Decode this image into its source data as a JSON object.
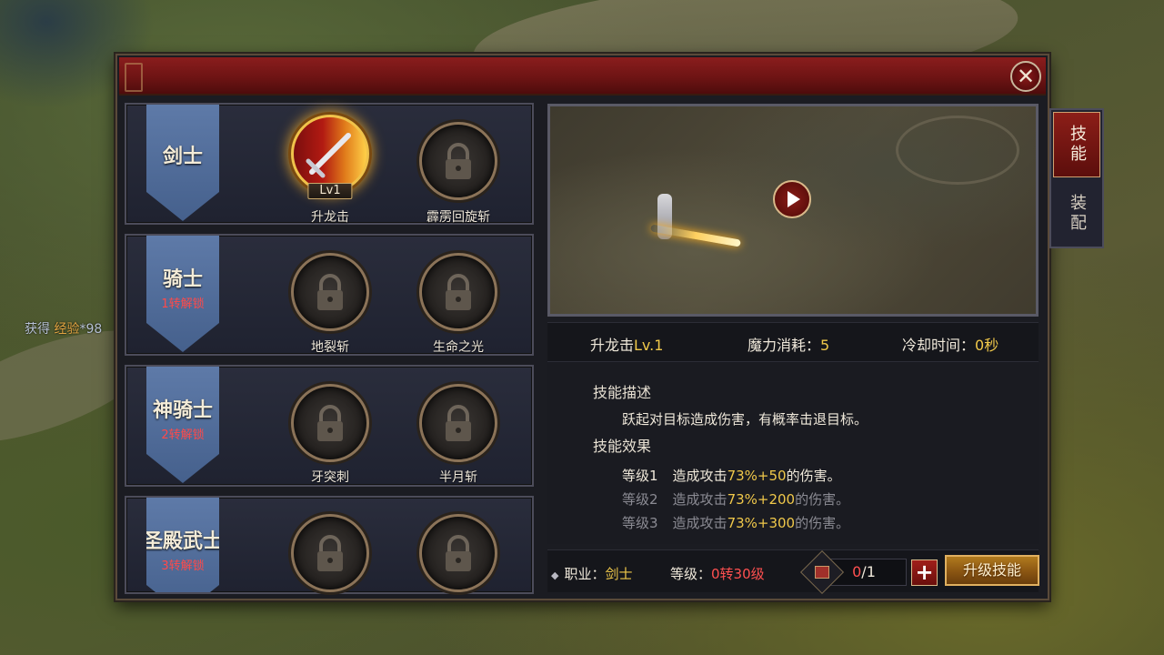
{
  "hud": {
    "xp_prefix": "获得",
    "xp_label": "经验",
    "xp_value": "*98"
  },
  "dialog": {
    "close_icon": "close-icon"
  },
  "classes": [
    {
      "name": "剑士",
      "unlock": "",
      "skills": [
        {
          "label": "升龙击",
          "level": "Lv1",
          "state": "active",
          "icon": "sword-icon"
        },
        {
          "label": "霹雳回旋斩",
          "level": "",
          "state": "locked",
          "icon": "lock-icon"
        }
      ]
    },
    {
      "name": "骑士",
      "unlock": "1转解锁",
      "skills": [
        {
          "label": "地裂斩",
          "level": "",
          "state": "locked",
          "icon": "lock-icon"
        },
        {
          "label": "生命之光",
          "level": "",
          "state": "locked",
          "icon": "lock-icon"
        }
      ]
    },
    {
      "name": "神骑士",
      "unlock": "2转解锁",
      "skills": [
        {
          "label": "牙突刺",
          "level": "",
          "state": "locked",
          "icon": "lock-icon"
        },
        {
          "label": "半月斩",
          "level": "",
          "state": "locked",
          "icon": "lock-icon"
        }
      ]
    },
    {
      "name": "圣殿武士",
      "unlock": "3转解锁",
      "skills": [
        {
          "label": "",
          "level": "",
          "state": "locked",
          "icon": "lock-icon"
        },
        {
          "label": "",
          "level": "",
          "state": "locked",
          "icon": "lock-icon"
        }
      ]
    }
  ],
  "detail": {
    "skill_name": "升龙击",
    "skill_level": "Lv.1",
    "mana_label": "魔力消耗：",
    "mana_value": "5",
    "cooldown_label": "冷却时间：",
    "cooldown_value": "0秒",
    "desc_heading": "技能描述",
    "desc_text": "跃起对目标造成伤害，有概率击退目标。",
    "effect_heading": "技能效果",
    "effects": [
      {
        "level": "等级1",
        "prefix": "造成攻击",
        "value": "73%+50",
        "suffix": "的伤害。",
        "active": true
      },
      {
        "level": "等级2",
        "prefix": "造成攻击",
        "value": "73%+200",
        "suffix": "的伤害。",
        "active": false
      },
      {
        "level": "等级3",
        "prefix": "造成攻击",
        "value": "73%+300",
        "suffix": "的伤害。",
        "active": false
      }
    ]
  },
  "footer": {
    "class_label": "职业：",
    "class_value": "剑士",
    "level_label": "等级：",
    "level_value": "0转30级",
    "count_current": "0",
    "count_total": "/1",
    "plus_label": "+",
    "upgrade_label": "升级技能"
  },
  "tabs": [
    {
      "label": "技能",
      "active": true
    },
    {
      "label": "装配",
      "active": false
    }
  ],
  "colors": {
    "gold": "#f0c84a",
    "red": "#ff5050",
    "panel": "#1b1c22",
    "title_red": "#8a1d1d"
  }
}
